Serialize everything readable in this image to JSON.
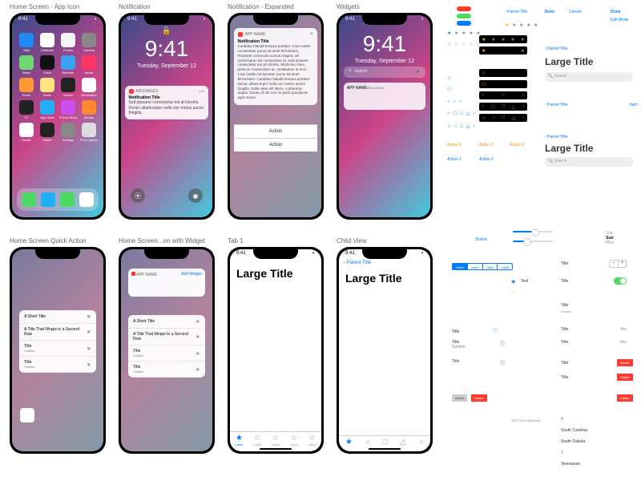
{
  "labels": {
    "home": "Home Screen - App Icon",
    "notif": "Notification",
    "notif_exp": "Notification - Expanded",
    "widgets": "Widgets",
    "quick": "Home Screen Quick Action",
    "quick_widget": "Home Screen...on with Widget",
    "tab1": "Tab 1",
    "child": "Child View"
  },
  "status": {
    "time": "9:41",
    "signal": "▪▪▪",
    "wifi": "◉",
    "battery": "▮"
  },
  "clock": {
    "time": "9:41",
    "date": "Tuesday, September 12"
  },
  "apps": [
    {
      "name": "Mail",
      "color": "#1e8bf7"
    },
    {
      "name": "Calendar",
      "color": "#ffffff"
    },
    {
      "name": "Photos",
      "color": "#f5f5f5"
    },
    {
      "name": "Camera",
      "color": "#888888"
    },
    {
      "name": "Maps",
      "color": "#6fd86f"
    },
    {
      "name": "Clock",
      "color": "#111111"
    },
    {
      "name": "Weather",
      "color": "#3aa0f0"
    },
    {
      "name": "News",
      "color": "#ff3366"
    },
    {
      "name": "Home",
      "color": "#ff9933"
    },
    {
      "name": "Notes",
      "color": "#ffe680"
    },
    {
      "name": "Stocks",
      "color": "#222222"
    },
    {
      "name": "Reminders",
      "color": "#ffffff"
    },
    {
      "name": "TV",
      "color": "#222222"
    },
    {
      "name": "App Store",
      "color": "#1fb0f7"
    },
    {
      "name": "iTunes Store",
      "color": "#c850f0"
    },
    {
      "name": "iBooks",
      "color": "#ff8833"
    },
    {
      "name": "Health",
      "color": "#ffffff"
    },
    {
      "name": "Wallet",
      "color": "#222222"
    },
    {
      "name": "Settings",
      "color": "#888888"
    },
    {
      "name": "iPod Classic",
      "color": "#dddddd"
    }
  ],
  "dock": [
    {
      "name": "Phone",
      "color": "#4cd964"
    },
    {
      "name": "Safari",
      "color": "#1fb0f7"
    },
    {
      "name": "Messages",
      "color": "#4cd964"
    },
    {
      "name": "Music",
      "color": "#ffffff"
    }
  ],
  "messages_notif": {
    "app": "MESSAGES",
    "title": "Notification Title",
    "body": "Sed posuere consectetur est at lobortis. Donec ullamcorper nulla non metus auctor fringilla.",
    "time": "now"
  },
  "expanded_notif": {
    "app": "APP NAME",
    "title": "Notification Title",
    "body": "Curabitur blandit tempus porttitor. Cras mattis consectetur purus sit amet fermentum. Praesent commodo cursus magna, vel scelerisque nisl consectetur et. Sed posuere consectetur est at lobortis. Morbi leo risus, porta ac consectetur ac, vestibulum at eros. Cras mattis consectetur purus sit amet fermentum. Curabitur blandit tempus porttitor. Donec ullamcorper nulla non metus auctor fringilla. Nulla vitae elit libero, a pharetra augue. Donec id elit non mi porta gravida at eget metus.",
    "action": "Action"
  },
  "widgets_card": {
    "app": "APP NAME",
    "more": "Show More"
  },
  "search": {
    "placeholder": "Search"
  },
  "quick_action": {
    "items": [
      {
        "title": "A Short Title",
        "sub": ""
      },
      {
        "title": "A Title That Wraps to a Second Row",
        "sub": ""
      },
      {
        "title": "Title",
        "sub": "Subtitle"
      },
      {
        "title": "Title",
        "sub": "Subtitle"
      }
    ],
    "add_widget": "Add Widget",
    "app": "APP NAME"
  },
  "nav": {
    "parent": "Parent Title",
    "large": "Large Title",
    "done": "Done",
    "cancel": "Cancel",
    "edit": "Edit Mode",
    "item": "Item"
  },
  "tab_label": "Label",
  "components": {
    "action": "Action 1",
    "action2": "Action 2",
    "action3": "Action 3",
    "button": "Button",
    "title": "Title",
    "subtitle": "Subtitle",
    "text": "Text",
    "delete": "Delete",
    "section": "SECTION HEADING",
    "states": [
      "A",
      "South Carolina",
      "South Dakota",
      "T",
      "Tennessee"
    ],
    "abc": "Abc"
  }
}
